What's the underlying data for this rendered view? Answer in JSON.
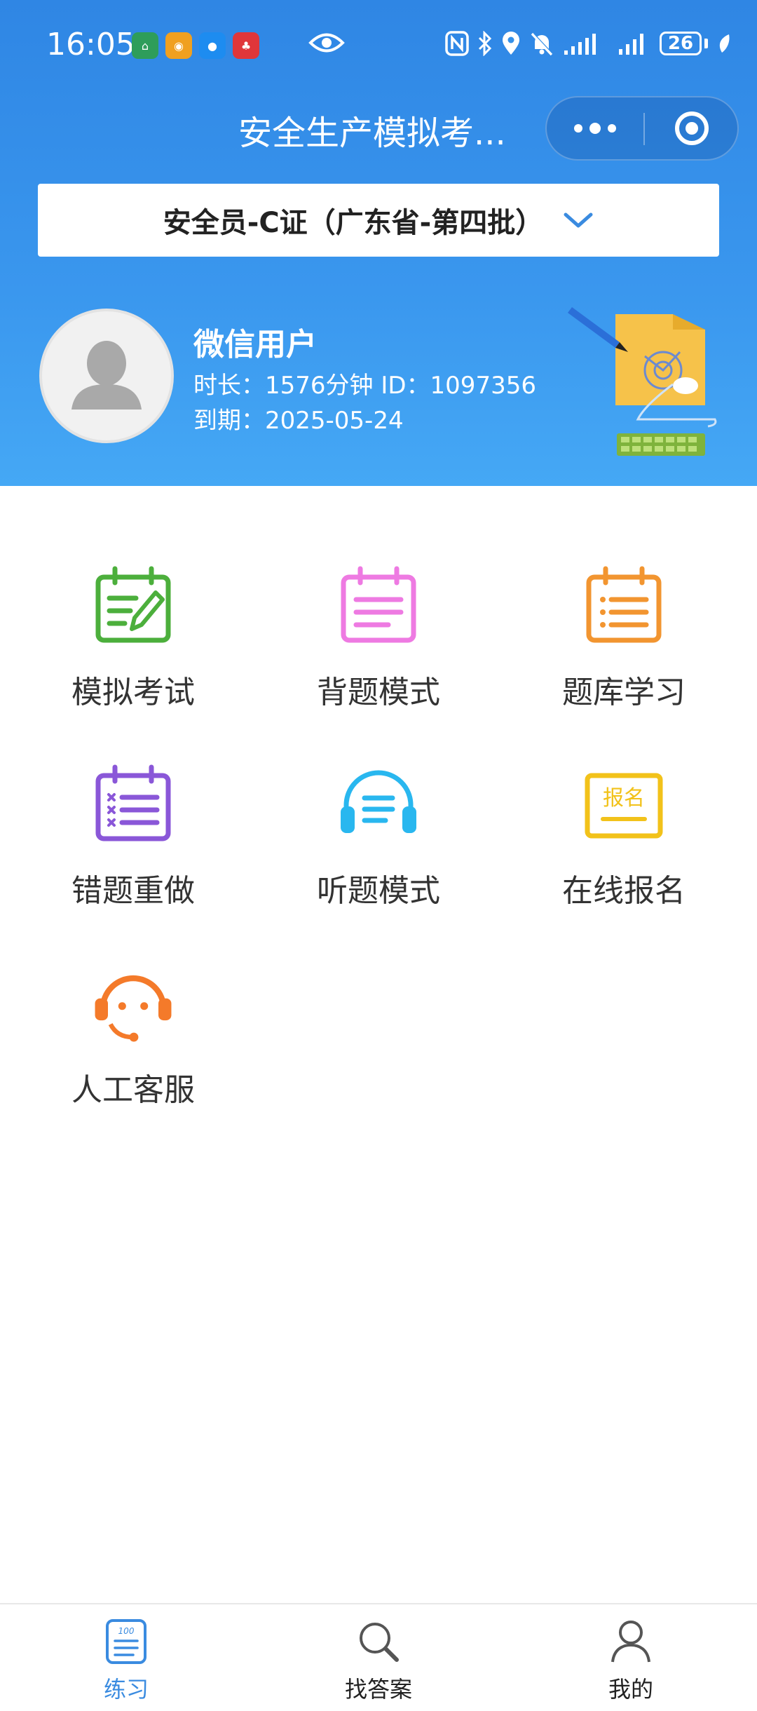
{
  "status_bar": {
    "time": "16:05",
    "battery": "26"
  },
  "nav": {
    "title": "安全生产模拟考..."
  },
  "selector": {
    "label": "安全员-C证（广东省-第四批）"
  },
  "profile": {
    "username": "微信用户",
    "duration_line": "时长：1576分钟 ID：1097356",
    "expiry_line": "到期：2025-05-24"
  },
  "menu": [
    {
      "label": "模拟考试",
      "icon": "exam-icon",
      "color": "#4caf3c"
    },
    {
      "label": "背题模式",
      "icon": "recite-icon",
      "color": "#ee7ae2"
    },
    {
      "label": "题库学习",
      "icon": "question-bank-icon",
      "color": "#f29530"
    },
    {
      "label": "错题重做",
      "icon": "wrong-questions-icon",
      "color": "#8a57d8"
    },
    {
      "label": "听题模式",
      "icon": "headphones-icon",
      "color": "#29b7ef"
    },
    {
      "label": "在线报名",
      "icon": "signup-icon",
      "color": "#f2c21a",
      "badge": "报名"
    },
    {
      "label": "人工客服",
      "icon": "customer-service-icon",
      "color": "#f47a2a"
    }
  ],
  "tabs": [
    {
      "label": "练习",
      "icon": "practice-icon",
      "active": true
    },
    {
      "label": "找答案",
      "icon": "search-icon",
      "active": false
    },
    {
      "label": "我的",
      "icon": "profile-icon",
      "active": false
    }
  ],
  "colors": {
    "header_gradient_top": "#2f86e4",
    "header_gradient_bottom": "#45a8f5",
    "tab_active": "#3a8be0"
  }
}
